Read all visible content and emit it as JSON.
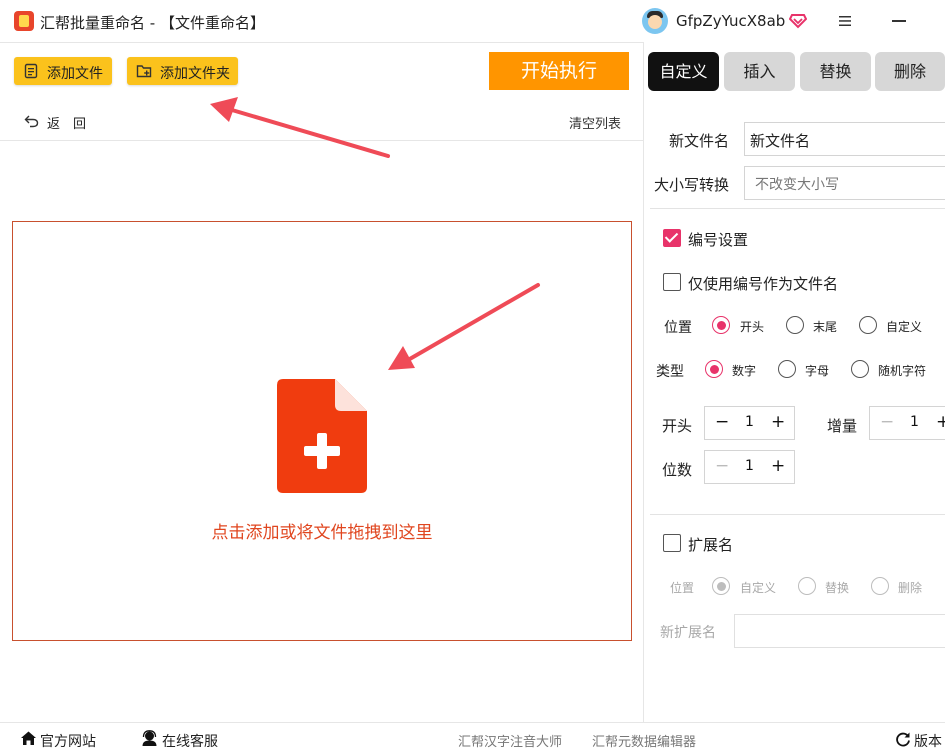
{
  "app": {
    "title": "汇帮批量重命名 - 【文件重命名】",
    "username": "GfpZyYucX8ab"
  },
  "toolbar": {
    "add_file": "添加文件",
    "add_folder": "添加文件夹",
    "start": "开始执行",
    "back": "返　回",
    "clear_list": "清空列表"
  },
  "dropzone": {
    "hint": "点击添加或将文件拖拽到这里"
  },
  "tabs": [
    {
      "label": "自定义",
      "active": true
    },
    {
      "label": "插入",
      "active": false
    },
    {
      "label": "替换",
      "active": false
    },
    {
      "label": "删除",
      "active": false
    }
  ],
  "form": {
    "new_name_label": "新文件名",
    "new_name_value": "新文件名",
    "case_label": "大小写转换",
    "case_value": "不改变大小写",
    "numbering_label": "编号设置",
    "numbering_checked": true,
    "only_number_label": "仅使用编号作为文件名",
    "only_number_checked": false,
    "position_label": "位置",
    "position_options": [
      "开头",
      "末尾",
      "自定义"
    ],
    "position_selected": "开头",
    "type_label": "类型",
    "type_options": [
      "数字",
      "字母",
      "随机字符"
    ],
    "type_selected": "数字",
    "start_label": "开头",
    "start_value": "1",
    "increment_label": "增量",
    "increment_value": "1",
    "digits_label": "位数",
    "digits_value": "1",
    "ext_label": "扩展名",
    "ext_checked": false,
    "ext_position_label": "位置",
    "ext_options": [
      "自定义",
      "替换",
      "删除"
    ],
    "ext_selected": "自定义",
    "new_ext_label": "新扩展名",
    "new_ext_value": ""
  },
  "footer": {
    "website": "官方网站",
    "support": "在线客服",
    "link1": "汇帮汉字注音大师",
    "link2": "汇帮元数据编辑器",
    "version": "版本"
  },
  "colors": {
    "accent": "#e8336a",
    "start_button": "#ff9500",
    "yellow_button": "#fbc21c",
    "drop_icon": "#f03c0f",
    "annotation_arrow": "#ef4b57"
  }
}
